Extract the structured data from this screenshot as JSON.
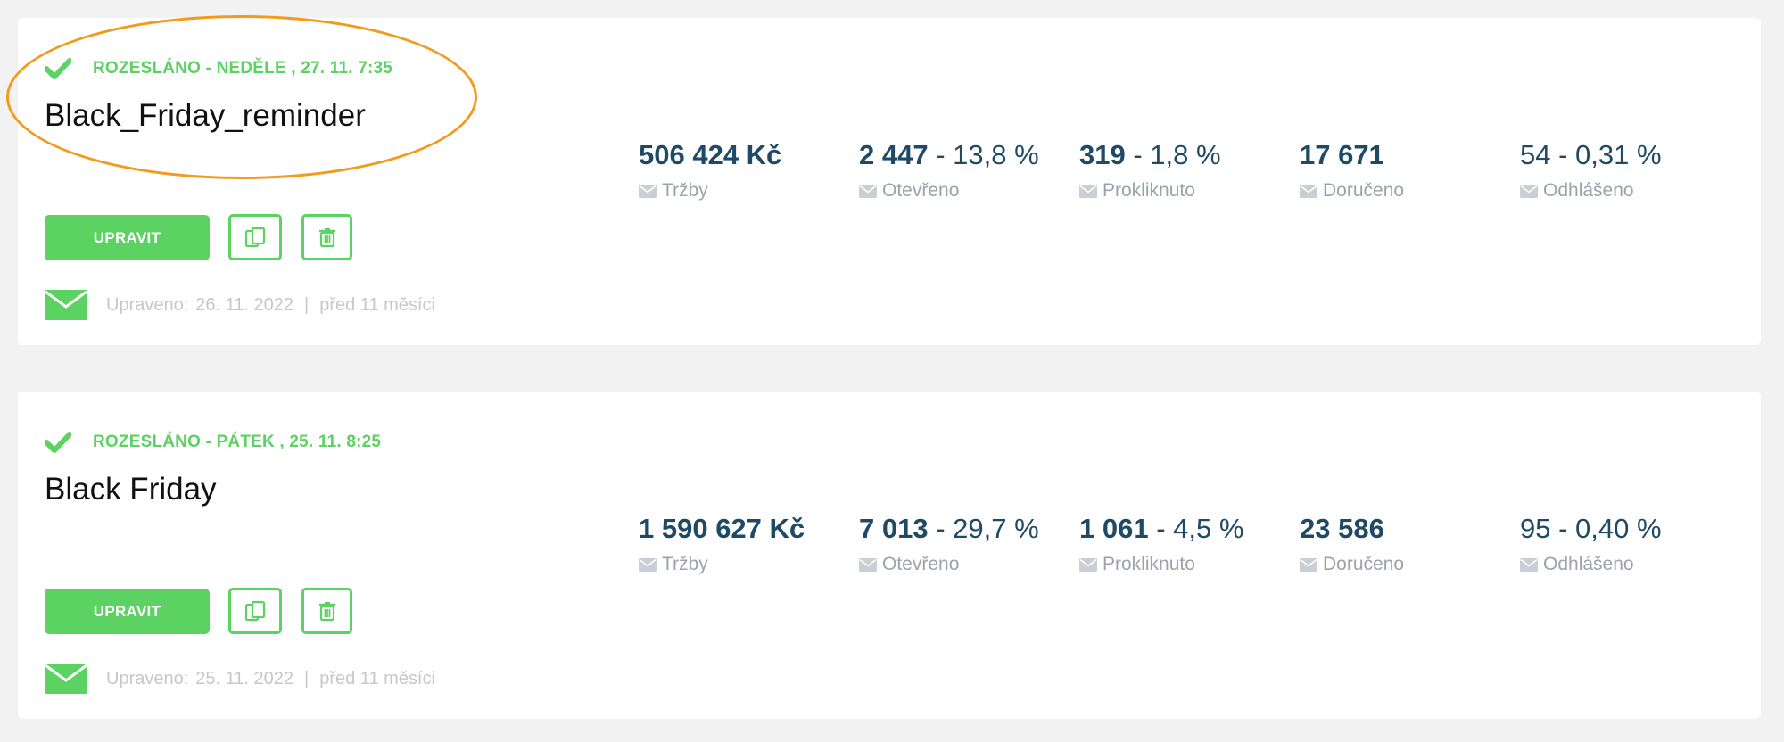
{
  "campaigns": [
    {
      "status": "ROZESLÁNO - NEDĚLE , 27. 11. 7:35",
      "name": "Black_Friday_reminder",
      "edit_label": "UPRAVIT",
      "modified_label": "Upraveno:",
      "modified_date": "26. 11. 2022",
      "separator": "|",
      "modified_ago": "před 11 měsíci",
      "stats": {
        "revenue": {
          "value": "506 424 Kč",
          "label": "Tržby"
        },
        "opened": {
          "value": "2 447",
          "pct": " - 13,8 %",
          "label": "Otevřeno"
        },
        "clicked": {
          "value": "319",
          "pct": " - 1,8 %",
          "label": "Prokliknuto"
        },
        "delivered": {
          "value": "17 671",
          "label": "Doručeno"
        },
        "unsubscribed": {
          "value": "54 - 0,31 %",
          "label": "Odhlášeno"
        }
      }
    },
    {
      "status": "ROZESLÁNO - PÁTEK , 25. 11. 8:25",
      "name": "Black Friday",
      "edit_label": "UPRAVIT",
      "modified_label": "Upraveno:",
      "modified_date": "25. 11. 2022",
      "separator": "|",
      "modified_ago": "před 11 měsíci",
      "stats": {
        "revenue": {
          "value": "1 590 627 Kč",
          "label": "Tržby"
        },
        "opened": {
          "value": "7 013",
          "pct": " - 29,7 %",
          "label": "Otevřeno"
        },
        "clicked": {
          "value": "1 061",
          "pct": " - 4,5 %",
          "label": "Prokliknuto"
        },
        "delivered": {
          "value": "23 586",
          "label": "Doručeno"
        },
        "unsubscribed": {
          "value": "95 - 0,40 %",
          "label": "Odhlášeno"
        }
      }
    }
  ],
  "icons": {
    "status": "check-icon",
    "copy": "copy-icon",
    "delete": "trash-icon",
    "footer": "envelope-icon",
    "stat": "envelope-icon"
  },
  "colors": {
    "accent_green": "#5cd262",
    "stat_value": "#1e4a66",
    "muted_label": "#9aa3ab",
    "highlight": "#f39a1c",
    "page_bg": "#f2f2f2"
  }
}
